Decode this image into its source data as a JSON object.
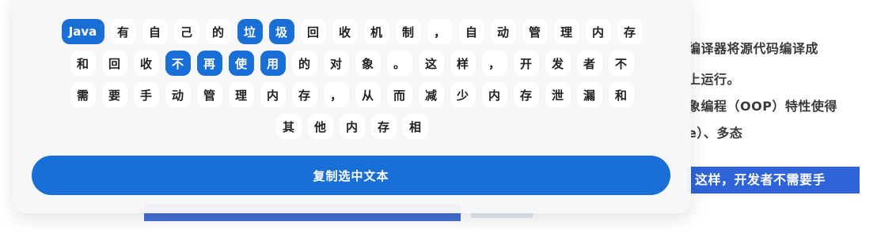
{
  "background": {
    "lines": [
      "编译器将源代码编译成",
      "上运行。",
      "象编程（OOP）特性使得",
      "e）、多态"
    ],
    "highlight": "这样，开发者不需要手"
  },
  "panel": {
    "rows": [
      [
        {
          "text": "Java",
          "selected": true
        },
        {
          "text": "有",
          "selected": false
        },
        {
          "text": "自",
          "selected": false
        },
        {
          "text": "己",
          "selected": false
        },
        {
          "text": "的",
          "selected": false
        },
        {
          "text": "垃",
          "selected": true
        },
        {
          "text": "圾",
          "selected": true
        },
        {
          "text": "回",
          "selected": false
        },
        {
          "text": "收",
          "selected": false
        },
        {
          "text": "机",
          "selected": false
        },
        {
          "text": "制",
          "selected": false
        },
        {
          "text": "，",
          "selected": false
        },
        {
          "text": "自",
          "selected": false
        },
        {
          "text": "动",
          "selected": false
        },
        {
          "text": "管",
          "selected": false
        },
        {
          "text": "理",
          "selected": false
        },
        {
          "text": "内",
          "selected": false
        },
        {
          "text": "存",
          "selected": false
        }
      ],
      [
        {
          "text": "和",
          "selected": false
        },
        {
          "text": "回",
          "selected": false
        },
        {
          "text": "收",
          "selected": false
        },
        {
          "text": "不",
          "selected": true
        },
        {
          "text": "再",
          "selected": true
        },
        {
          "text": "使",
          "selected": true
        },
        {
          "text": "用",
          "selected": true
        },
        {
          "text": "的",
          "selected": false
        },
        {
          "text": "对",
          "selected": false
        },
        {
          "text": "象",
          "selected": false
        },
        {
          "text": "。",
          "selected": false
        },
        {
          "text": "这",
          "selected": false
        },
        {
          "text": "样",
          "selected": false
        },
        {
          "text": "，",
          "selected": false
        },
        {
          "text": "开",
          "selected": false
        },
        {
          "text": "发",
          "selected": false
        },
        {
          "text": "者",
          "selected": false
        },
        {
          "text": "不",
          "selected": false
        }
      ],
      [
        {
          "text": "需",
          "selected": false
        },
        {
          "text": "要",
          "selected": false
        },
        {
          "text": "手",
          "selected": false
        },
        {
          "text": "动",
          "selected": false
        },
        {
          "text": "管",
          "selected": false
        },
        {
          "text": "理",
          "selected": false
        },
        {
          "text": "内",
          "selected": false
        },
        {
          "text": "存",
          "selected": false
        },
        {
          "text": "，",
          "selected": false
        },
        {
          "text": "从",
          "selected": false
        },
        {
          "text": "而",
          "selected": false
        },
        {
          "text": "减",
          "selected": false
        },
        {
          "text": "少",
          "selected": false
        },
        {
          "text": "内",
          "selected": false
        },
        {
          "text": "存",
          "selected": false
        },
        {
          "text": "泄",
          "selected": false
        },
        {
          "text": "漏",
          "selected": false
        },
        {
          "text": "和",
          "selected": false
        }
      ],
      [
        {
          "text": "其",
          "selected": false
        },
        {
          "text": "他",
          "selected": false
        },
        {
          "text": "内",
          "selected": false
        },
        {
          "text": "存",
          "selected": false
        },
        {
          "text": "相",
          "selected": false
        }
      ]
    ],
    "copy_button": "复制选中文本"
  },
  "colors": {
    "accent": "#1a6fd6",
    "background_highlight": "#2f63d8"
  }
}
